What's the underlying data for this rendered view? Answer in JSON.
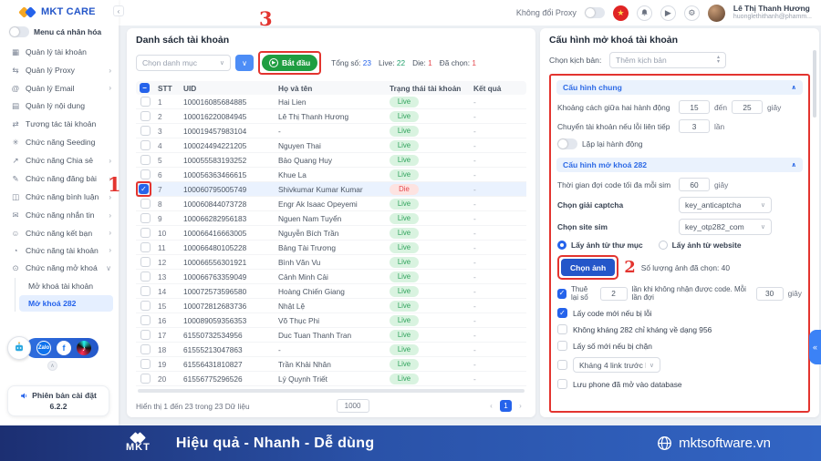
{
  "icons": {
    "gear": "⚙",
    "play": "▶",
    "star": "★",
    "chevron_down": "∨",
    "chevron_up": "∧",
    "prev": "‹",
    "next": "›",
    "collapse": "‹",
    "edge_collapse": "«",
    "updown": "▲\n▼",
    "zalo": "Zalo",
    "facebook": "f",
    "music": "♪",
    "handle": "∧"
  },
  "topbar": {
    "proxy_label": "Không đổi Proxy",
    "user_name": "Lê Thị Thanh Hương",
    "user_email": "huonglethithanh@phamm..."
  },
  "sidebar": {
    "brand": "MKT CARE",
    "personal_toggle": "Menu cá nhân hóa",
    "items": [
      {
        "icon": "▦",
        "label": "Quản lý tài khoản",
        "chev": ""
      },
      {
        "icon": "⇆",
        "label": "Quản lý Proxy",
        "chev": "›"
      },
      {
        "icon": "@",
        "label": "Quản lý Email",
        "chev": "›"
      },
      {
        "icon": "▤",
        "label": "Quản lý nội dung",
        "chev": ""
      },
      {
        "icon": "⇄",
        "label": "Tương tác tài khoản",
        "chev": ""
      },
      {
        "icon": "✳",
        "label": "Chức năng Seeding",
        "chev": ""
      },
      {
        "icon": "↗",
        "label": "Chức năng Chia sẻ",
        "chev": "›"
      },
      {
        "icon": "✎",
        "label": "Chức năng đăng bài",
        "chev": "›"
      },
      {
        "icon": "◫",
        "label": "Chức năng bình luận",
        "chev": "›"
      },
      {
        "icon": "✉",
        "label": "Chức năng nhắn tin",
        "chev": "›"
      },
      {
        "icon": "☺",
        "label": "Chức năng kết bạn",
        "chev": "›"
      },
      {
        "icon": "◔",
        "label": "Chức năng tài khoản",
        "chev": "›"
      },
      {
        "icon": "⊙",
        "label": "Chức năng mở khoá",
        "chev": "∨"
      }
    ],
    "subitems": [
      {
        "label": "Mở khoá tài khoản",
        "cls": ""
      },
      {
        "label": "Mở khoá 282",
        "cls": "active"
      }
    ],
    "version_label": "Phiên bản cài đặt",
    "version": "6.2.2"
  },
  "table": {
    "title": "Danh sách tài khoản",
    "category_placeholder": "Chọn danh mục",
    "start_button": "Bắt đầu",
    "stats": {
      "total_label": "Tổng số:",
      "total": "23",
      "live_label": "Live:",
      "live": "22",
      "die_label": "Die:",
      "die": "1",
      "selected_label": "Đã chọn:",
      "selected": "1"
    },
    "headers": {
      "stt": "STT",
      "uid": "UID",
      "name": "Họ và tên",
      "status": "Trạng thái tài khoản",
      "result": "Kết quả"
    },
    "rows": [
      {
        "stt": "1",
        "uid": "100016085684885",
        "name": "Hai Lien",
        "status": "Live",
        "status_class": "live",
        "result": "-",
        "cb": "",
        "box": "",
        "row": ""
      },
      {
        "stt": "2",
        "uid": "100016220084945",
        "name": "Lê Thị Thanh Hương",
        "status": "Live",
        "status_class": "live",
        "result": "-",
        "cb": "",
        "box": "",
        "row": ""
      },
      {
        "stt": "3",
        "uid": "100019457983104",
        "name": "-",
        "status": "Live",
        "status_class": "live",
        "result": "-",
        "cb": "",
        "box": "",
        "row": ""
      },
      {
        "stt": "4",
        "uid": "100024494221205",
        "name": "Nguyen Thai",
        "status": "Live",
        "status_class": "live",
        "result": "-",
        "cb": "",
        "box": "",
        "row": ""
      },
      {
        "stt": "5",
        "uid": "100055583193252",
        "name": "Bảo Quang Huy",
        "status": "Live",
        "status_class": "live",
        "result": "-",
        "cb": "",
        "box": "",
        "row": ""
      },
      {
        "stt": "6",
        "uid": "100056363466615",
        "name": "Khue La",
        "status": "Live",
        "status_class": "live",
        "result": "-",
        "cb": "",
        "box": "",
        "row": ""
      },
      {
        "stt": "7",
        "uid": "100060795005749",
        "name": "Shivkumar Kumar Kumar",
        "status": "Die",
        "status_class": "die",
        "result": "-",
        "cb": "checked",
        "box": "annot",
        "row": "sel-row"
      },
      {
        "stt": "8",
        "uid": "100060844073728",
        "name": "Engr Ak Isaac Opeyemi",
        "status": "Live",
        "status_class": "live",
        "result": "-",
        "cb": "",
        "box": "",
        "row": ""
      },
      {
        "stt": "9",
        "uid": "100066282956183",
        "name": "Nguen Nam Tuyển",
        "status": "Live",
        "status_class": "live",
        "result": "-",
        "cb": "",
        "box": "",
        "row": ""
      },
      {
        "stt": "10",
        "uid": "100066416663005",
        "name": "Nguyễn Bích Trần",
        "status": "Live",
        "status_class": "live",
        "result": "-",
        "cb": "",
        "box": "",
        "row": ""
      },
      {
        "stt": "11",
        "uid": "100066480105228",
        "name": "Bảng Tài Trương",
        "status": "Live",
        "status_class": "live",
        "result": "-",
        "cb": "",
        "box": "",
        "row": ""
      },
      {
        "stt": "12",
        "uid": "100066556301921",
        "name": "Bình Văn Vu",
        "status": "Live",
        "status_class": "live",
        "result": "-",
        "cb": "",
        "box": "",
        "row": ""
      },
      {
        "stt": "13",
        "uid": "100066763359049",
        "name": "Cảnh Minh Cải",
        "status": "Live",
        "status_class": "live",
        "result": "-",
        "cb": "",
        "box": "",
        "row": ""
      },
      {
        "stt": "14",
        "uid": "100072573596580",
        "name": "Hoàng Chiến Giang",
        "status": "Live",
        "status_class": "live",
        "result": "-",
        "cb": "",
        "box": "",
        "row": ""
      },
      {
        "stt": "15",
        "uid": "100072812683736",
        "name": "Nhật Lệ",
        "status": "Live",
        "status_class": "live",
        "result": "-",
        "cb": "",
        "box": "",
        "row": ""
      },
      {
        "stt": "16",
        "uid": "100089059356353",
        "name": "Võ Thục Phi",
        "status": "Live",
        "status_class": "live",
        "result": "-",
        "cb": "",
        "box": "",
        "row": ""
      },
      {
        "stt": "17",
        "uid": "61550732534956",
        "name": "Duc Tuan Thanh Tran",
        "status": "Live",
        "status_class": "live",
        "result": "-",
        "cb": "",
        "box": "",
        "row": ""
      },
      {
        "stt": "18",
        "uid": "61555213047863",
        "name": "-",
        "status": "Live",
        "status_class": "live",
        "result": "-",
        "cb": "",
        "box": "",
        "row": ""
      },
      {
        "stt": "19",
        "uid": "61556431810827",
        "name": "Trần Khải Nhân",
        "status": "Live",
        "status_class": "live",
        "result": "-",
        "cb": "",
        "box": "",
        "row": ""
      },
      {
        "stt": "20",
        "uid": "61556775296526",
        "name": "Lý Quynh Triết",
        "status": "Live",
        "status_class": "live",
        "result": "-",
        "cb": "",
        "box": "",
        "row": ""
      }
    ],
    "footer_text": "Hiển thị 1 đến 23 trong 23 Dữ liệu",
    "page_size": "1000",
    "page": "1"
  },
  "panel": {
    "title": "Cấu hình mở khoá tài khoản",
    "scenario_label": "Chọn kịch bản:",
    "scenario_placeholder": "Thêm kịch bản",
    "general": {
      "title": "Cấu hình chung",
      "gap_label": "Khoảng cách giữa hai hành động",
      "gap_min": "15",
      "gap_mid": "đến",
      "gap_max": "25",
      "gap_unit": "giây",
      "switch_label": "Chuyển tài khoản nếu lỗi liên tiếp",
      "switch_value": "3",
      "switch_unit": "lần",
      "repeat_label": "Lặp lại hành động"
    },
    "unlock": {
      "title": "Cấu hình mở khoá 282",
      "wait_label": "Thời gian đợi code tối đa mỗi sim",
      "wait_value": "60",
      "wait_unit": "giây",
      "captcha_label": "Chọn giải captcha",
      "captcha_value": "key_anticaptcha",
      "sitesim_label": "Chọn site sim",
      "sitesim_value": "key_otp282_com",
      "radio_folder": "Lấy ảnh từ thư mục",
      "radio_website": "Lấy ảnh từ website",
      "choose_image_button": "Chọn ảnh",
      "chosen_count_text": "Số lượng ảnh đã chọn: 40",
      "rent_label": "Thuê lại số",
      "rent_times": "2",
      "rent_desc": "lần khi không nhận được code. Mỗi lần đợi",
      "rent_wait": "30",
      "rent_unit": "giây",
      "opt_newcode": "Lấy code mới nếu bị lỗi",
      "opt_no282": "Không kháng 282 chỉ kháng về dạng 956",
      "opt_newnumber": "Lấy số mới nếu bị chặn",
      "opt_4link": "Kháng 4 link trước k...",
      "opt_savephone": "Lưu phone đã mở vào database"
    }
  },
  "annotations": {
    "step1": "1",
    "step2": "2",
    "step3": "3"
  },
  "footer": {
    "logo": "MKT",
    "slogan": "Hiệu quả - Nhanh - Dễ dùng",
    "site": "mktsoftware.vn"
  }
}
